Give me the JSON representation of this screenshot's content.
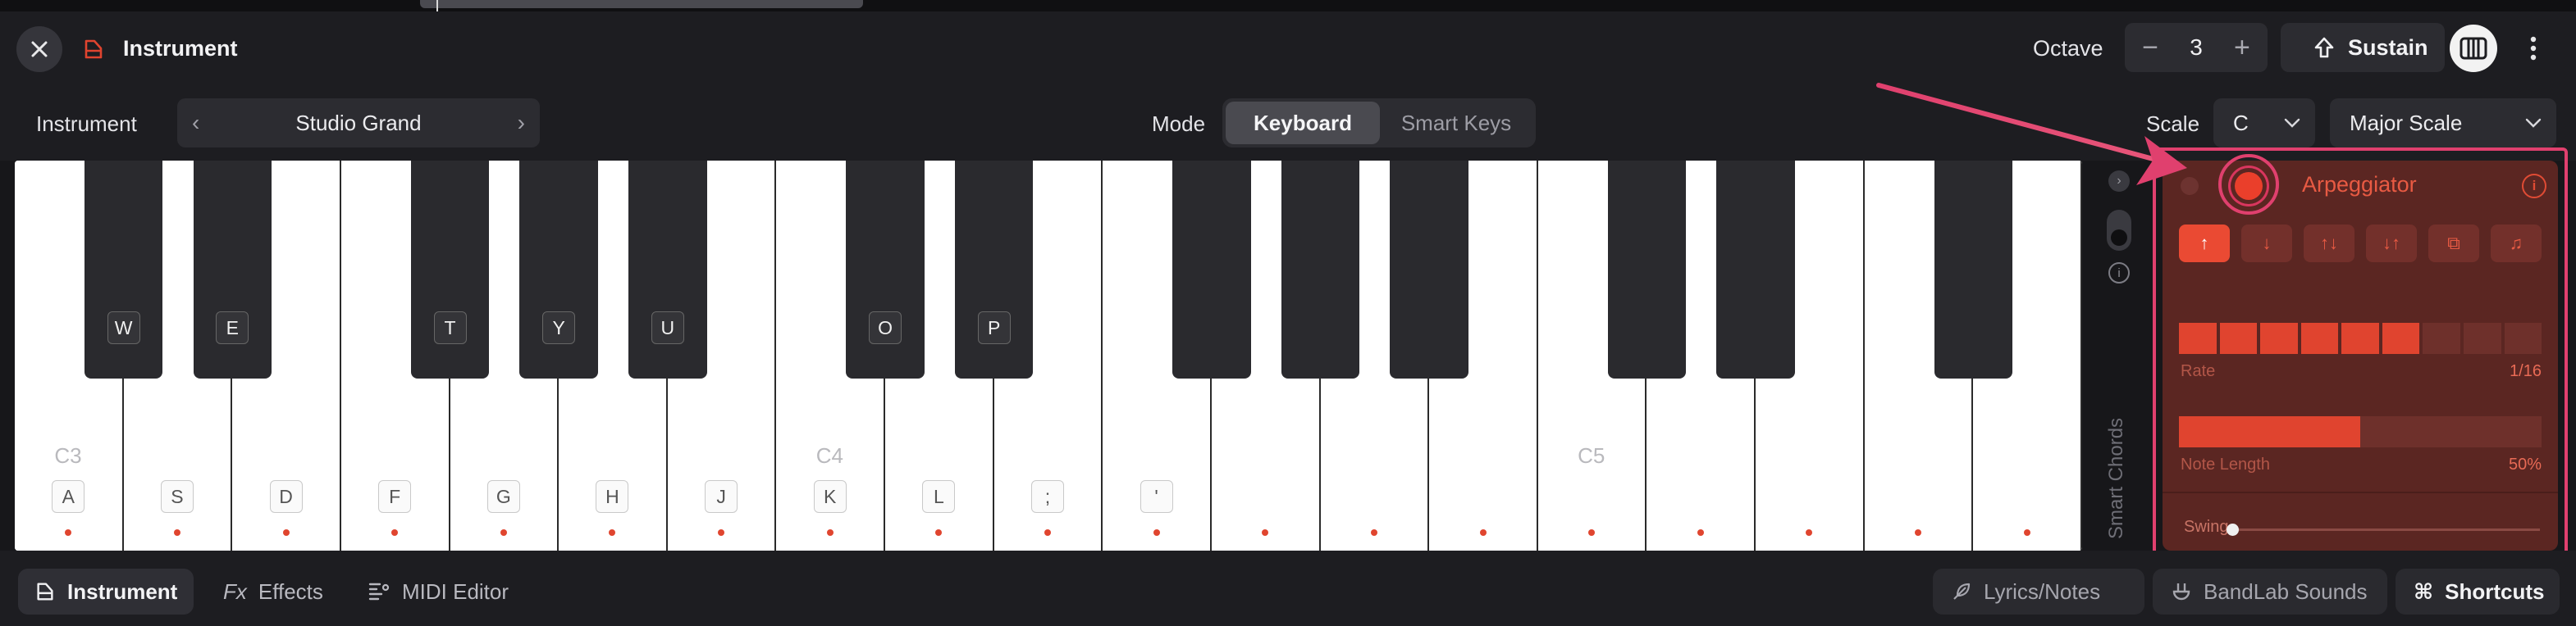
{
  "header": {
    "title": "Instrument",
    "octave_label": "Octave",
    "octave_minus": "−",
    "octave_value": "3",
    "octave_plus": "+",
    "sustain_label": "Sustain"
  },
  "controls": {
    "instrument_label": "Instrument",
    "instrument_value": "Studio Grand",
    "prev": "‹",
    "next": "›",
    "mode_label": "Mode",
    "mode_options": [
      "Keyboard",
      "Smart Keys"
    ],
    "mode_selected": "Keyboard",
    "scale_label": "Scale",
    "scale_key": "C",
    "scale_type": "Major Scale",
    "chevron": "⌄"
  },
  "keyboard": {
    "white_keys": [
      {
        "kb": "A",
        "note": "C3"
      },
      {
        "kb": "S",
        "note": ""
      },
      {
        "kb": "D",
        "note": ""
      },
      {
        "kb": "F",
        "note": ""
      },
      {
        "kb": "G",
        "note": ""
      },
      {
        "kb": "H",
        "note": ""
      },
      {
        "kb": "J",
        "note": ""
      },
      {
        "kb": "K",
        "note": "C4"
      },
      {
        "kb": "L",
        "note": ""
      },
      {
        "kb": ";",
        "note": ""
      },
      {
        "kb": "'",
        "note": ""
      },
      {
        "kb": "",
        "note": ""
      },
      {
        "kb": "",
        "note": ""
      },
      {
        "kb": "",
        "note": ""
      },
      {
        "kb": "",
        "note": "C5"
      },
      {
        "kb": "",
        "note": ""
      },
      {
        "kb": "",
        "note": ""
      },
      {
        "kb": "",
        "note": ""
      },
      {
        "kb": "",
        "note": ""
      }
    ],
    "black_keys": [
      "W",
      "E",
      "T",
      "Y",
      "U",
      "O",
      "P",
      "",
      "",
      "",
      "",
      "",
      ""
    ]
  },
  "side": {
    "expand": "›",
    "info": "i",
    "smart_chords_label": "Smart Chords"
  },
  "arpeggiator": {
    "title": "Arpeggiator",
    "info": "i",
    "directions": [
      {
        "icon": "arrow-up-icon",
        "glyph": "↑",
        "active": true
      },
      {
        "icon": "arrow-down-icon",
        "glyph": "↓",
        "active": false
      },
      {
        "icon": "up-down-icon",
        "glyph": "↑↓",
        "active": false
      },
      {
        "icon": "down-up-icon",
        "glyph": "↓↑",
        "active": false
      },
      {
        "icon": "random-icon",
        "glyph": "⧉",
        "active": false
      },
      {
        "icon": "note-icon",
        "glyph": "♫",
        "active": false
      }
    ],
    "rate_label": "Rate",
    "rate_value": "1/16",
    "rate_level_segments_on": 6,
    "rate_total_segments": 9,
    "note_length_label": "Note Length",
    "note_length_value": "50%",
    "note_length_fraction": 0.5,
    "swing_label": "Swing",
    "swing_fraction": 0.0
  },
  "bottom": {
    "tabs": [
      "Instrument",
      "Effects",
      "MIDI Editor"
    ],
    "fx_glyph": "Fx",
    "lyrics_label": "Lyrics/Notes",
    "sounds_label": "BandLab Sounds",
    "shortcuts_label": "Shortcuts"
  },
  "colors": {
    "accent": "#e0442f",
    "annotation": "#e0406e",
    "panel": "#5b2622"
  }
}
